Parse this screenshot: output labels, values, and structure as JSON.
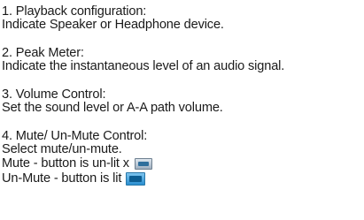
{
  "sections": [
    {
      "heading": "1. Playback configuration:",
      "description": "Indicate Speaker or Headphone device."
    },
    {
      "heading": "2. Peak Meter:",
      "description": "Indicate the instantaneous level of an audio signal."
    },
    {
      "heading": "3. Volume Control:",
      "description": "Set the sound level or A-A path volume."
    },
    {
      "heading": "4. Mute/ Un-Mute Control:",
      "description": "Select mute/un-mute.",
      "mute_line": "Mute - button is un-lit x",
      "unmute_line": "Un-Mute - button is lit"
    }
  ],
  "icons": {
    "mute_button": "mute-button-unlit-icon",
    "unmute_button": "unmute-button-lit-icon"
  }
}
